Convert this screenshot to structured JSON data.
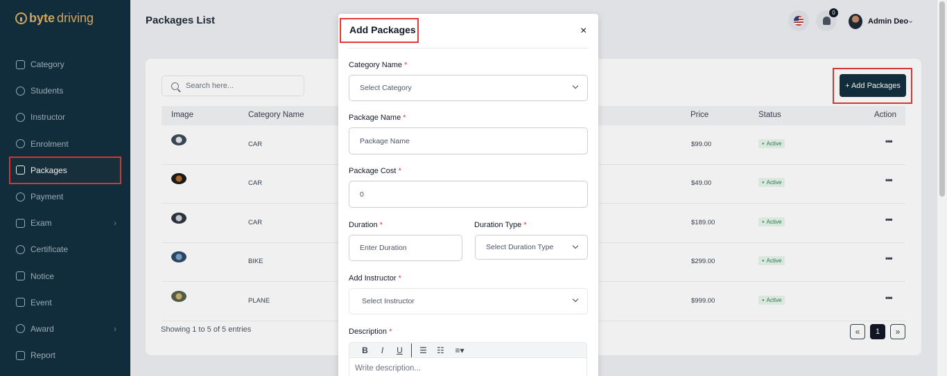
{
  "brand": {
    "part1": "byte",
    "part2": "driving",
    "accent": "#e0b062"
  },
  "sidebar": {
    "items": [
      {
        "label": "Category",
        "icon": "bag-icon"
      },
      {
        "label": "Students",
        "icon": "users-icon"
      },
      {
        "label": "Instructor",
        "icon": "user-icon"
      },
      {
        "label": "Enrolment",
        "icon": "enrolment-icon"
      },
      {
        "label": "Packages",
        "icon": "layers-icon",
        "active": true
      },
      {
        "label": "Payment",
        "icon": "dollar-icon"
      },
      {
        "label": "Exam",
        "icon": "exam-icon",
        "submenu": true
      },
      {
        "label": "Certificate",
        "icon": "certificate-icon"
      },
      {
        "label": "Notice",
        "icon": "notice-icon"
      },
      {
        "label": "Event",
        "icon": "calendar-icon"
      },
      {
        "label": "Award",
        "icon": "award-icon",
        "submenu": true
      },
      {
        "label": "Report",
        "icon": "report-icon"
      }
    ]
  },
  "header": {
    "title": "Packages List",
    "notification_count": "0",
    "user_name": "Admin Deo",
    "chevron": "⌄"
  },
  "list": {
    "search_placeholder": "Search here...",
    "add_button": "+ Add Packages",
    "columns": {
      "image": "Image",
      "category": "Category Name",
      "price": "Price",
      "status": "Status",
      "action": "Action"
    },
    "rows": [
      {
        "category": "CAR",
        "price": "$99.00",
        "status": "Active"
      },
      {
        "category": "CAR",
        "price": "$49.00",
        "status": "Active"
      },
      {
        "category": "CAR",
        "price": "$189.00",
        "status": "Active"
      },
      {
        "category": "BIKE",
        "price": "$299.00",
        "status": "Active"
      },
      {
        "category": "PLANE",
        "price": "$999.00",
        "status": "Active"
      }
    ],
    "action_glyph": "•••",
    "showing": "Showing 1 to 5 of 5 entries",
    "pagination": {
      "prev": "«",
      "current": "1",
      "next": "»"
    }
  },
  "modal": {
    "title": "Add Packages",
    "close": "×",
    "required_mark": "*",
    "category_label": "Category Name",
    "category_placeholder": "Select Category",
    "package_name_label": "Package Name",
    "package_name_placeholder": "Package Name",
    "package_cost_label": "Package Cost",
    "package_cost_value": "0",
    "duration_label": "Duration",
    "duration_placeholder": "Enter Duration",
    "duration_type_label": "Duration Type",
    "duration_type_placeholder": "Select Duration Type",
    "instructor_label": "Add Instructor",
    "instructor_placeholder": "Select Instructor",
    "description_label": "Description",
    "description_placeholder": "Write description...",
    "toolbar": {
      "bold": "B",
      "italic": "I",
      "underline": "U",
      "bullet_list": "☰",
      "ordered_list": "☷",
      "align": "≡▾"
    }
  },
  "colors": {
    "sidebar_bg": "#13303f",
    "highlight": "#e53935",
    "status_green": "#2e7d4f"
  }
}
